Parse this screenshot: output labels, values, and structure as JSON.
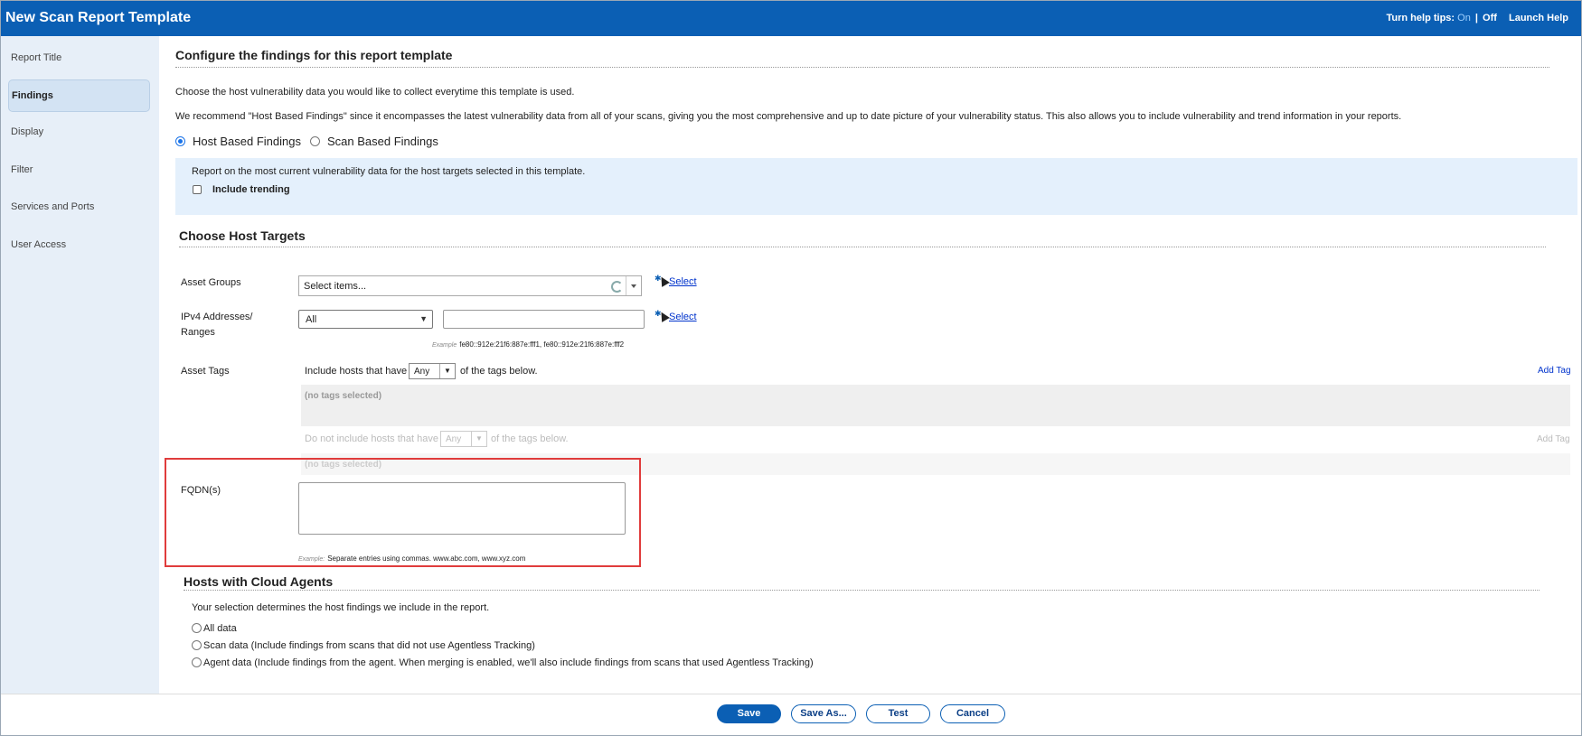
{
  "header": {
    "title": "New Scan Report Template",
    "help_tips_label": "Turn help tips:",
    "help_on": "On",
    "help_sep": "|",
    "help_off": "Off",
    "launch_help": "Launch Help"
  },
  "sidebar": {
    "items": [
      {
        "label": "Report Title"
      },
      {
        "label": "Findings"
      },
      {
        "label": "Display"
      },
      {
        "label": "Filter"
      },
      {
        "label": "Services and Ports"
      },
      {
        "label": "User Access"
      }
    ]
  },
  "findings": {
    "heading": "Configure the findings for this report template",
    "intro": "Choose the host vulnerability data you would like to collect everytime this template is used.",
    "recommend": "We recommend \"Host Based Findings\" since it encompasses the latest vulnerability data from all of your scans, giving you the most comprehensive and up to date picture of your vulnerability status. This also allows you to include vulnerability and trend information in your reports.",
    "host_based_label": "Host Based Findings",
    "scan_based_label": "Scan Based Findings",
    "info_text": "Report on the most current vulnerability data for the host targets selected in this template.",
    "include_trending_label": "Include trending"
  },
  "host_targets": {
    "heading": "Choose Host Targets",
    "asset_groups_label": "Asset Groups",
    "asset_groups_placeholder": "Select items...",
    "select_link": "Select",
    "ipv4_label_1": "IPv4 Addresses/",
    "ipv4_label_2": "Ranges",
    "ipv4_dropdown_value": "All",
    "ipv4_example_label": "Example",
    "ipv4_example": "fe80::912e:21f6:887e:fff1, fe80::912e:21f6:887e:fff2",
    "asset_tags_label": "Asset Tags",
    "include_hosts_text": "Include hosts that have",
    "include_any": "Any",
    "of_tags_below": "of the tags below.",
    "add_tag": "Add Tag",
    "no_tags": "(no tags selected)",
    "exclude_hosts_text": "Do not include hosts that have",
    "exclude_any": "Any",
    "fqdn_label": "FQDN(s)",
    "fqdn_example_label": "Example:",
    "fqdn_example": "Separate entries using commas. www.abc.com, www.xyz.com"
  },
  "cloud_agents": {
    "heading": "Hosts with Cloud Agents",
    "intro": "Your selection determines the host findings we include in the report.",
    "options": [
      {
        "label": "All data"
      },
      {
        "label": "Scan data (Include findings from scans that did not use Agentless Tracking)"
      },
      {
        "label": "Agent data (Include findings from the agent. When merging is enabled, we'll also include findings from scans that used Agentless Tracking)"
      }
    ]
  },
  "footer": {
    "save": "Save",
    "save_as": "Save As...",
    "test": "Test",
    "cancel": "Cancel"
  },
  "colors": {
    "header_bg": "#0b5fb4",
    "sidebar_bg": "#e7eff8",
    "highlight": "#e03c3c"
  }
}
